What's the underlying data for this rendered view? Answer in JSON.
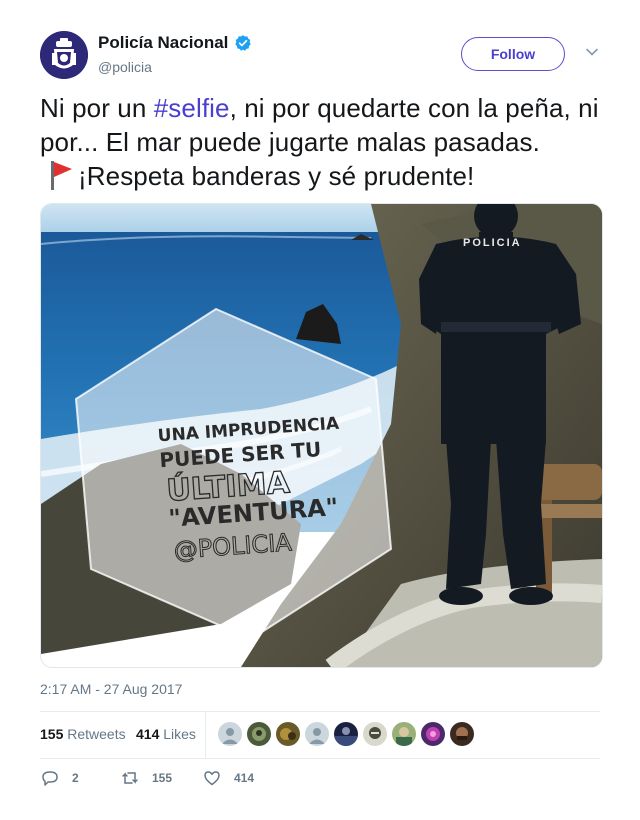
{
  "author": {
    "display_name": "Policía Nacional",
    "handle": "@policia",
    "verified": true
  },
  "follow_label": "Follow",
  "tweet": {
    "text_part1": "Ni por un ",
    "hashtag": "#selfie",
    "text_part2": ", ni por quedarte con la peña, ni por... El mar puede jugarte malas pasadas.",
    "text_part3": "¡Respeta banderas y sé prudente!",
    "emoji_icon": "red-flag-icon"
  },
  "media": {
    "overlay_lines": [
      "UNA IMPRUDENCIA",
      "PUEDE SER TU",
      "ÚLTIMA",
      "\"AVENTURA\"",
      "@POLICIA"
    ],
    "uniform_text": "POLICIA"
  },
  "timestamp": "2:17 AM - 27 Aug 2017",
  "stats": {
    "retweets_count": "155",
    "retweets_label": "Retweets",
    "likes_count": "414",
    "likes_label": "Likes"
  },
  "actions": {
    "replies": "2",
    "retweets": "155",
    "likes": "414"
  },
  "colors": {
    "accent": "#4a3fcf",
    "verified": "#1da1f2",
    "muted": "#657786"
  }
}
